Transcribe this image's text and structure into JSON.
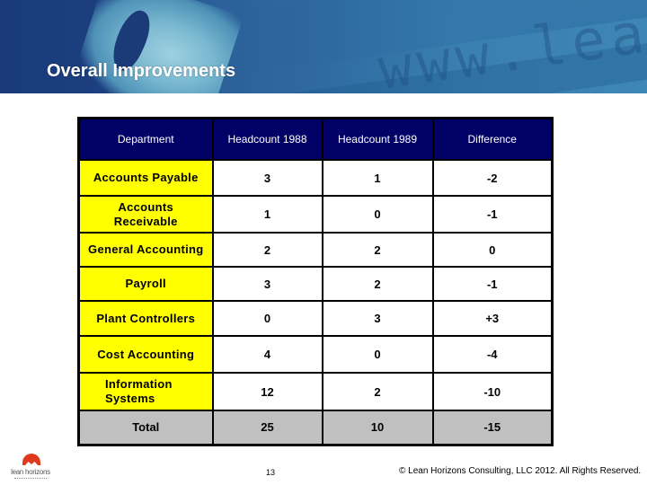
{
  "slide": {
    "title": "Overall Improvements",
    "banner_text": "www.lea",
    "page_number": "13",
    "copyright": "© Lean Horizons Consulting, LLC 2012. All Rights Reserved.",
    "logo_text": "lean horizons"
  },
  "colors": {
    "header_bg": "#000066",
    "department_bg": "#ffff00",
    "total_bg": "#c0c0c0",
    "banner_dark": "#1a3a7a",
    "banner_light": "#3e86b4",
    "logo_red": "#e03a1e"
  },
  "table": {
    "headers": [
      "Department",
      "Headcount 1988",
      "Headcount 1989",
      "Difference"
    ],
    "rows": [
      {
        "department": "Accounts Payable",
        "hc1988": "3",
        "hc1989": "1",
        "difference": "-2"
      },
      {
        "department": "Accounts Receivable",
        "hc1988": "1",
        "hc1989": "0",
        "difference": "-1"
      },
      {
        "department": "General Accounting",
        "hc1988": "2",
        "hc1989": "2",
        "difference": "0"
      },
      {
        "department": "Payroll",
        "hc1988": "3",
        "hc1989": "2",
        "difference": "-1"
      },
      {
        "department": "Plant Controllers",
        "hc1988": "0",
        "hc1989": "3",
        "difference": "+3"
      },
      {
        "department": "Cost Accounting",
        "hc1988": "4",
        "hc1989": "0",
        "difference": "-4"
      },
      {
        "department": "Information Systems",
        "hc1988": "12",
        "hc1989": "2",
        "difference": "-10"
      }
    ],
    "total": {
      "label": "Total",
      "hc1988": "25",
      "hc1989": "10",
      "difference": "-15"
    }
  }
}
